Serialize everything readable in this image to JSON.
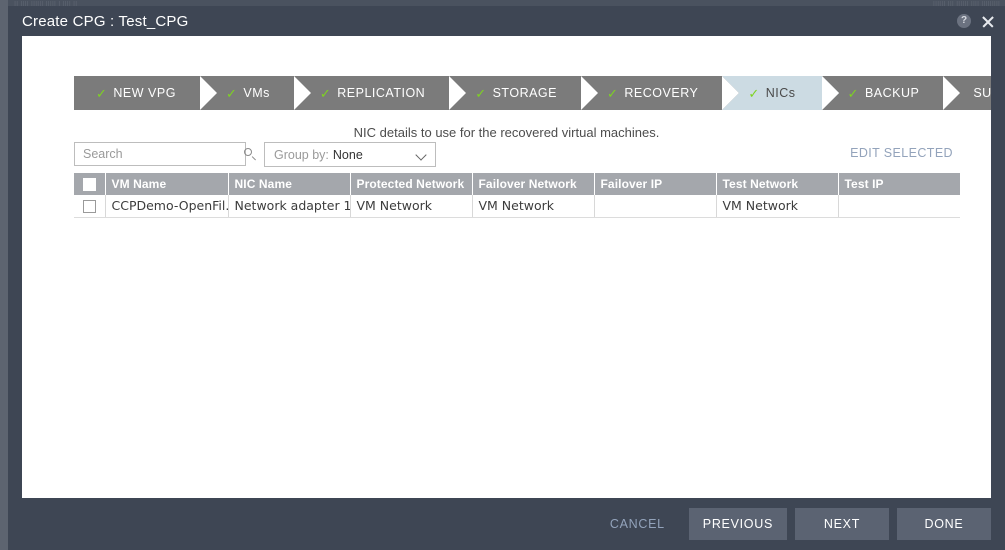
{
  "window": {
    "title": "Create CPG : Test_CPG",
    "help_icon": "help-icon",
    "close_icon": "close-icon",
    "background_ghost_left": "|| |||| |||||| ||||| | |||| ||",
    "background_ghost_right": "|||||| ||| ||||||     ||||       |||||||||"
  },
  "wizard": {
    "steps": [
      {
        "label": "NEW VPG",
        "done": true,
        "active": false,
        "check": "✓"
      },
      {
        "label": "VMs",
        "done": true,
        "active": false,
        "check": "✓"
      },
      {
        "label": "REPLICATION",
        "done": true,
        "active": false,
        "check": "✓"
      },
      {
        "label": "STORAGE",
        "done": true,
        "active": false,
        "check": "✓"
      },
      {
        "label": "RECOVERY",
        "done": true,
        "active": false,
        "check": "✓"
      },
      {
        "label": "NICs",
        "done": true,
        "active": true,
        "check": "✓"
      },
      {
        "label": "BACKUP",
        "done": true,
        "active": false,
        "check": "✓"
      },
      {
        "label": "SUMMARY",
        "done": false,
        "active": false,
        "check": ""
      }
    ],
    "active_step": "NICs",
    "check_color": "#7ed321",
    "step_bg": "#7b7b7b",
    "active_step_bg": "#ccdbe3"
  },
  "subtitle": "NIC details to use for the recovered virtual machines.",
  "toolbar": {
    "search_placeholder": "Search",
    "search_value": "",
    "search_icon": "search-icon",
    "groupby_label": "Group by:",
    "groupby_value": "None",
    "groupby_options": [
      "None"
    ],
    "edit_selected_label": "EDIT SELECTED",
    "edit_selected_color": "#93a3bb"
  },
  "table": {
    "select_all_checked": false,
    "columns": [
      "VM Name",
      "NIC Name",
      "Protected Network",
      "Failover Network",
      "Failover IP",
      "Test Network",
      "Test IP"
    ],
    "rows": [
      {
        "checked": false,
        "vm_name": "CCPDemo-OpenFil...",
        "nic_name": "Network adapter 1",
        "protected_network": "VM Network",
        "failover_network": "VM Network",
        "failover_ip": "",
        "test_network": "VM Network",
        "test_ip": ""
      }
    ],
    "header_bg": "#a4a7ac"
  },
  "footer": {
    "cancel_label": "CANCEL",
    "previous_label": "PREVIOUS",
    "next_label": "NEXT",
    "done_label": "DONE",
    "button_bg": "#5b6372",
    "bar_bg": "#3e4654"
  }
}
